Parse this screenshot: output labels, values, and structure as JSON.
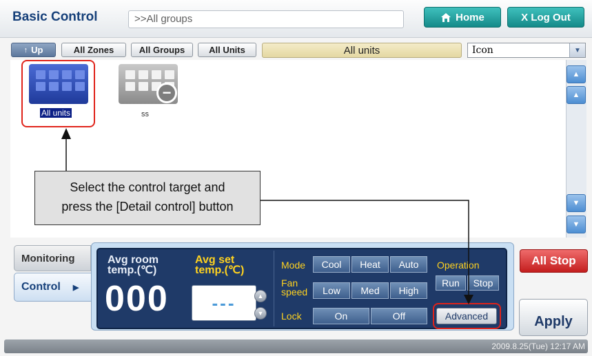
{
  "header": {
    "title": "Basic Control",
    "breadcrumb": ">>All groups",
    "home_label": "Home",
    "logout_label": "X Log Out"
  },
  "toolbar": {
    "up_label": "Up",
    "all_zones_label": "All Zones",
    "all_groups_label": "All Groups",
    "all_units_label": "All Units",
    "current_view": "All units",
    "view_mode": "Icon"
  },
  "items": [
    {
      "label": "All units",
      "selected": true,
      "icon": "grid-units-icon"
    },
    {
      "label": "ss",
      "selected": false,
      "icon": "grid-units-minus-icon"
    }
  ],
  "callout": {
    "line1": "Select the control target and",
    "line2": "press the [Detail control] button"
  },
  "sidebar": {
    "monitoring_label": "Monitoring",
    "control_label": "Control"
  },
  "control": {
    "avg_room_label_1": "Avg room",
    "avg_room_label_2": "temp.(℃)",
    "avg_room_value": "000",
    "avg_set_label_1": "Avg set",
    "avg_set_label_2": "temp.(℃)",
    "avg_set_value": "---",
    "mode_label": "Mode",
    "mode_options": [
      "Cool",
      "Heat",
      "Auto"
    ],
    "fan_label_1": "Fan",
    "fan_label_2": "speed",
    "fan_options": [
      "Low",
      "Med",
      "High"
    ],
    "lock_label": "Lock",
    "lock_options": [
      "On",
      "Off"
    ],
    "operation_label": "Operation",
    "run_label": "Run",
    "stop_label": "Stop",
    "advanced_label": "Advanced"
  },
  "actions": {
    "all_stop_label": "All Stop",
    "apply_label": "Apply"
  },
  "status": {
    "datetime": "2009.8.25(Tue)  12:17 AM"
  },
  "colors": {
    "accent": "#158a89",
    "panel": "#1f3a68",
    "highlight": "#e0231a",
    "stop": "#c41e1e"
  }
}
